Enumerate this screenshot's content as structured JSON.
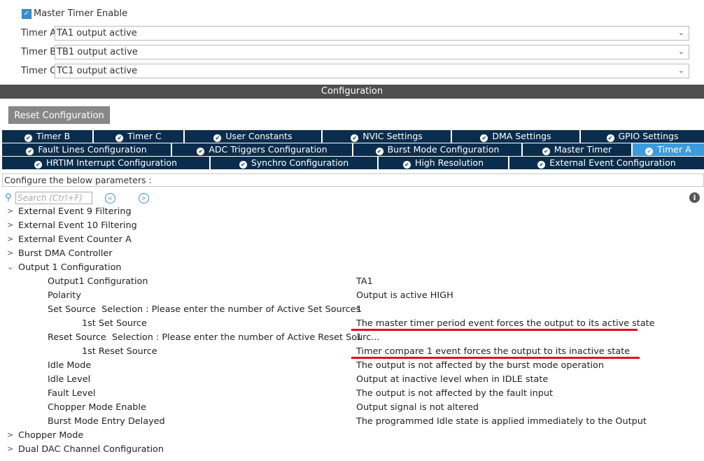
{
  "master_timer": {
    "enable_label": "Master Timer Enable",
    "checked": true
  },
  "timers": [
    {
      "label": "Timer A",
      "value": "TA1 output active"
    },
    {
      "label": "Timer B",
      "value": "TB1 output active"
    },
    {
      "label": "Timer C",
      "value": "TC1 output active"
    }
  ],
  "configuration_title": "Configuration",
  "reset_button": "Reset Configuration",
  "tabs_row1": [
    "Timer B",
    "Timer C",
    "User Constants",
    "NVIC Settings",
    "DMA Settings",
    "GPIO Settings"
  ],
  "tabs_row2": [
    "Fault Lines Configuration",
    "ADC Triggers Configuration",
    "Burst Mode Configuration",
    "Master Timer",
    "Timer A"
  ],
  "tabs_row3": [
    "HRTIM Interrupt Configuration",
    "Synchro Configuration",
    "High Resolution",
    "External Event Configuration"
  ],
  "active_tab": "Timer A",
  "configure_text": "Configure the below parameters :",
  "search_placeholder": "Search (Ctrl+F)",
  "tree": [
    {
      "label": "External Event 9 Filtering",
      "expanded": false
    },
    {
      "label": "External Event 10 Filtering",
      "expanded": false
    },
    {
      "label": "External Event Counter A",
      "expanded": false
    },
    {
      "label": "Burst DMA Controller",
      "expanded": false
    },
    {
      "label": "Output 1 Configuration",
      "expanded": true
    }
  ],
  "params": [
    {
      "name": "Output1 Configuration",
      "value": "TA1"
    },
    {
      "name": "Polarity",
      "value": "Output is active HIGH"
    },
    {
      "name": "Set Source  Selection : Please enter the number of Active Set Sources",
      "value": "1"
    },
    {
      "name": "1st Set Source",
      "value": "The master timer period event forces the output to its active state"
    },
    {
      "name": "Reset Source  Selection : Please enter the number of Active Reset Sourc...",
      "value": "1"
    },
    {
      "name": "1st Reset Source",
      "value": "Timer compare 1 event forces the output to its inactive state"
    },
    {
      "name": "Idle Mode",
      "value": "The output is not affected by the burst mode operation"
    },
    {
      "name": "Idle Level",
      "value": "Output at inactive level when in IDLE state"
    },
    {
      "name": "Fault Level",
      "value": "The output is not affected by the fault input"
    },
    {
      "name": "Chopper Mode Enable",
      "value": "Output signal is not altered"
    },
    {
      "name": "Burst Mode Entry Delayed",
      "value": "The programmed Idle state is applied immediately to the Output"
    }
  ],
  "tree_after": [
    {
      "label": "Chopper Mode",
      "expanded": false
    },
    {
      "label": "Dual DAC Channel Configuration",
      "expanded": false
    }
  ],
  "colors": {
    "tab_bg": "#0b2d4d",
    "tab_active": "#3b9bdc",
    "annotation": "#e01020"
  }
}
